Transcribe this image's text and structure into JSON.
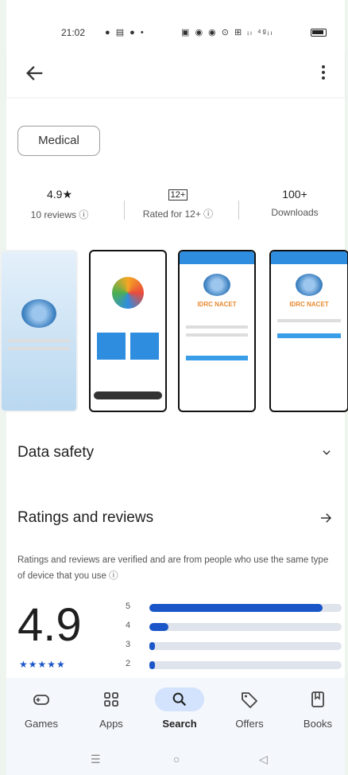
{
  "status_bar": {
    "time": "21:02",
    "left_icons": "● ▤ ● •",
    "right_icons": "▣ ◉ ◉ ⊙ ⊞ ᵢₗ ⁴ᵍᵢₗ"
  },
  "app_bar": {
    "back_icon": "arrow-left-icon",
    "more_icon": "more-vert-icon"
  },
  "category_chip": "Medical",
  "stats": {
    "rating": "4.9★",
    "reviews": "10 reviews ⓘ",
    "content_rating_badge": "12+",
    "content_rating": "Rated for 12+ ⓘ",
    "downloads": "100+",
    "downloads_label": "Downloads"
  },
  "screenshots": {
    "c_brand": "IDRC NACET",
    "d_brand": "IDRC NACET"
  },
  "data_safety": {
    "title": "Data safety"
  },
  "ratings": {
    "title": "Ratings and reviews",
    "description": "Ratings and reviews are verified and are from people who use the same type of device that you use ⓘ",
    "score": "4.9",
    "stars": "★★★★★",
    "bars": [
      {
        "label": "5",
        "fraction": 0.9
      },
      {
        "label": "4",
        "fraction": 0.1
      },
      {
        "label": "3",
        "fraction": 0.03
      },
      {
        "label": "2",
        "fraction": 0.03
      }
    ]
  },
  "bottom_nav": {
    "items": [
      {
        "label": "Games",
        "icon": "gamepad-icon"
      },
      {
        "label": "Apps",
        "icon": "apps-grid-icon"
      },
      {
        "label": "Search",
        "icon": "search-icon"
      },
      {
        "label": "Offers",
        "icon": "tag-icon"
      },
      {
        "label": "Books",
        "icon": "bookmark-icon"
      }
    ],
    "active": "Search"
  },
  "system_nav": {
    "recents": "☰",
    "home": "○",
    "back": "◁"
  },
  "colors": {
    "accent": "#1a56c8",
    "nav_bg": "#f4f7fb",
    "active_pill": "#d3e3fd"
  }
}
